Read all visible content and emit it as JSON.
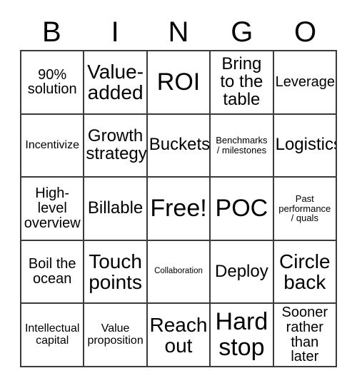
{
  "card": {
    "title": "BINGO",
    "header_letters": [
      "B",
      "I",
      "N",
      "G",
      "O"
    ],
    "free_space_label": "Free!",
    "colors": {
      "background": "#ffffff",
      "text": "#000000",
      "border": "#3a3a3a"
    },
    "rows": [
      [
        {
          "label": "90%\nsolution",
          "size": "md"
        },
        {
          "label": "Value-\nadded",
          "size": "xl"
        },
        {
          "label": "ROI",
          "size": "xxl"
        },
        {
          "label": "Bring\nto the\ntable",
          "size": "lg"
        },
        {
          "label": "Leverage",
          "size": "md"
        }
      ],
      [
        {
          "label": "Incentivize",
          "size": "sm"
        },
        {
          "label": "Growth\nstrategy",
          "size": "lg"
        },
        {
          "label": "Buckets",
          "size": "lg"
        },
        {
          "label": "Benchmarks\n/ milestones",
          "size": "xs"
        },
        {
          "label": "Logistics",
          "size": "lg"
        }
      ],
      [
        {
          "label": "High-\nlevel\noverview",
          "size": "md"
        },
        {
          "label": "Billable",
          "size": "lg"
        },
        {
          "label": "Free!",
          "size": "xxl"
        },
        {
          "label": "POC",
          "size": "xxl"
        },
        {
          "label": "Past\nperformance\n/ quals",
          "size": "xs"
        }
      ],
      [
        {
          "label": "Boil the\nocean",
          "size": "md"
        },
        {
          "label": "Touch\npoints",
          "size": "xl"
        },
        {
          "label": "Collaboration",
          "size": "xxs"
        },
        {
          "label": "Deploy",
          "size": "lg"
        },
        {
          "label": "Circle\nback",
          "size": "xl"
        }
      ],
      [
        {
          "label": "Intellectual\ncapital",
          "size": "sm"
        },
        {
          "label": "Value\nproposition",
          "size": "sm"
        },
        {
          "label": "Reach\nout",
          "size": "xl"
        },
        {
          "label": "Hard\nstop",
          "size": "xxl"
        },
        {
          "label": "Sooner\nrather\nthan later",
          "size": "md"
        }
      ]
    ]
  }
}
